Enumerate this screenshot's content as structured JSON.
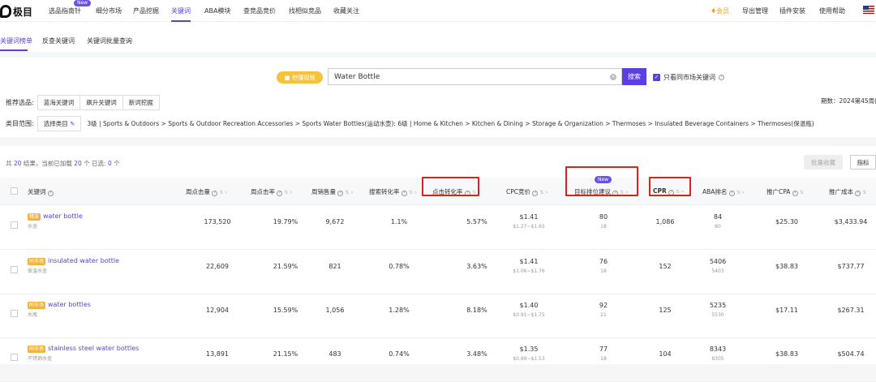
{
  "topnav": {
    "logo_text": "极目",
    "new_badge": "New",
    "items": [
      "选品指南针",
      "细分市场",
      "产品挖掘",
      "关键词",
      "ABA模块",
      "查竞品竞价",
      "找相似竞品",
      "收藏关注"
    ],
    "vip": "会员",
    "right_items": [
      "导出管理",
      "插件安装",
      "使用帮助"
    ]
  },
  "subtabs": [
    "关键词榜单",
    "反查关键词",
    "关键词批量查询"
  ],
  "search": {
    "quick_label": "秒懂视频",
    "query": "Water Bottle",
    "button": "搜索",
    "same_site_label": "只看同市场关键词"
  },
  "reco": {
    "label": "推荐选品:",
    "chips": [
      "蓝海关键词",
      "飙升关键词",
      "新词挖掘"
    ]
  },
  "period": "期数：2024第45周(",
  "category": {
    "label": "类目范围:",
    "button": "选择类目",
    "path": "3级 | Sports & Outdoors > Sports & Outdoor Recreation Accessories > Sports Water Bottles(运动水壶): 6级 | Home & Kitchen > Kitchen & Dining > Storage & Organization > Thermoses > Insulated Beverage Containers > Thermoses(保温瓶)"
  },
  "results": {
    "prefix": "共",
    "total": "20",
    "mid1": "结果，当前已加载",
    "loaded": "20",
    "mid2": "个  已选:",
    "selected": "0",
    "suffix": "个",
    "batch_fav": "批量收藏",
    "metrics": "指标"
  },
  "columns": [
    "关键词",
    "周点击量",
    "周点击率",
    "周销售量",
    "搜索转化率",
    "点击转化率",
    "CPC竞价",
    "目标排位建议",
    "CPR",
    "ABA排名",
    "推广CPA",
    "推广成本"
  ],
  "new_column_badge": "New",
  "rows": [
    {
      "tag": "精准",
      "keyword": "water bottle",
      "sub": "水壶",
      "clicks": "173,520",
      "ctr": "19.79%",
      "sales": "9,672",
      "search_cvr": "1.1%",
      "click_cvr": "5.57%",
      "cpc": "$1.41",
      "cpc_range": "$1.27~$1.65",
      "rank": "80",
      "rank_sub": "18",
      "cpr": "1,086",
      "aba": "84",
      "aba_sub": "80",
      "cpa": "$25.30",
      "cost": "$3,433.94"
    },
    {
      "tag": "同市场",
      "keyword": "insulated water bottle",
      "sub": "保温水壶",
      "clicks": "22,609",
      "ctr": "21.59%",
      "sales": "821",
      "search_cvr": "0.78%",
      "click_cvr": "3.63%",
      "cpc": "$1.41",
      "cpc_range": "$1.06~$1.76",
      "rank": "76",
      "rank_sub": "18",
      "cpr": "152",
      "aba": "5406",
      "aba_sub": "5403",
      "cpa": "$38.83",
      "cost": "$737.77"
    },
    {
      "tag": "同市场",
      "keyword": "water bottles",
      "sub": "水瓶",
      "clicks": "12,904",
      "ctr": "15.59%",
      "sales": "1,056",
      "search_cvr": "1.28%",
      "click_cvr": "8.18%",
      "cpc": "$1.40",
      "cpc_range": "$0.91~$1.75",
      "rank": "92",
      "rank_sub": "21",
      "cpr": "125",
      "aba": "5235",
      "aba_sub": "5530",
      "cpa": "$17.11",
      "cost": "$267.31"
    },
    {
      "tag": "同市场",
      "keyword": "stainless steel water bottles",
      "sub": "不锈钢水壶",
      "clicks": "13,891",
      "ctr": "21.15%",
      "sales": "483",
      "search_cvr": "0.74%",
      "click_cvr": "3.48%",
      "cpc": "$1.35",
      "cpc_range": "$0.89~$1.53",
      "rank": "77",
      "rank_sub": "18",
      "cpr": "104",
      "aba": "8343",
      "aba_sub": "8305",
      "cpa": "$38.83",
      "cost": "$504.74"
    }
  ],
  "colors": {
    "accent": "#5b3fe0",
    "tag": "#f4b23a",
    "highlight": "#e0201b"
  },
  "icons": [
    "logo-icon",
    "video-icon",
    "clear-icon",
    "info-icon",
    "edit-icon",
    "sort-icon",
    "filter-icon",
    "flag-icon"
  ]
}
